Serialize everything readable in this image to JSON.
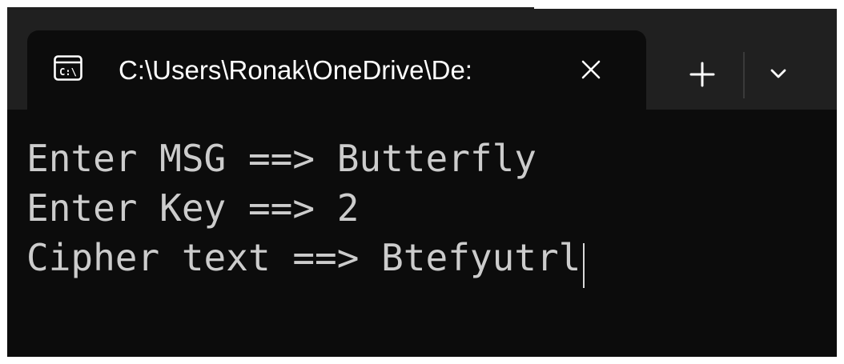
{
  "tab": {
    "icon": "command-prompt-icon",
    "title": "C:\\Users\\Ronak\\OneDrive\\De:"
  },
  "controls": {
    "close_icon": "close-icon",
    "new_tab_icon": "plus-icon",
    "dropdown_icon": "chevron-down-icon"
  },
  "console": {
    "lines": [
      "Enter MSG ==> Butterfly",
      "Enter Key ==> 2",
      "Cipher text ==> Btefyutrl"
    ]
  },
  "colors": {
    "console_bg": "#0c0c0c",
    "titlebar_bg": "#202020",
    "console_text": "#cccccc"
  }
}
